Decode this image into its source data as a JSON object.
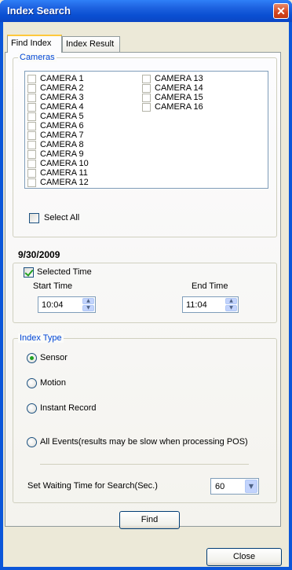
{
  "window": {
    "title": "Index Search",
    "close_glyph": "✕"
  },
  "tabs": [
    {
      "label": "Find Index",
      "active": true
    },
    {
      "label": "Index Result",
      "active": false
    }
  ],
  "cameras": {
    "group_label": "Cameras",
    "items": [
      {
        "label": "CAMERA 1",
        "checked": false
      },
      {
        "label": "CAMERA 2",
        "checked": false
      },
      {
        "label": "CAMERA 3",
        "checked": false
      },
      {
        "label": "CAMERA 4",
        "checked": false
      },
      {
        "label": "CAMERA 5",
        "checked": false
      },
      {
        "label": "CAMERA 6",
        "checked": false
      },
      {
        "label": "CAMERA 7",
        "checked": false
      },
      {
        "label": "CAMERA 8",
        "checked": false
      },
      {
        "label": "CAMERA 9",
        "checked": false
      },
      {
        "label": "CAMERA 10",
        "checked": false
      },
      {
        "label": "CAMERA 11",
        "checked": false
      },
      {
        "label": "CAMERA 12",
        "checked": false
      },
      {
        "label": "CAMERA 13",
        "checked": false
      },
      {
        "label": "CAMERA 14",
        "checked": false
      },
      {
        "label": "CAMERA 15",
        "checked": false
      },
      {
        "label": "CAMERA 16",
        "checked": false
      }
    ],
    "select_all_label": "Select All",
    "select_all_checked": false
  },
  "date": "9/30/2009",
  "time": {
    "selected_time_label": "Selected Time",
    "selected_time_checked": true,
    "start_label": "Start Time",
    "start_value": "10:04",
    "end_label": "End Time",
    "end_value": "11:04"
  },
  "index_type": {
    "group_label": "Index Type",
    "options": [
      {
        "label": "Sensor",
        "selected": true
      },
      {
        "label": "Motion",
        "selected": false
      },
      {
        "label": "Instant Record",
        "selected": false
      },
      {
        "label": "All Events(results may be slow when processing POS)",
        "selected": false
      }
    ],
    "waiting_label": "Set Waiting Time for Search(Sec.)",
    "waiting_value": "60"
  },
  "buttons": {
    "find": "Find",
    "close": "Close"
  },
  "colors": {
    "title_bar": "#0a4fd2",
    "group_label": "#0046d5",
    "check_mark": "#21a121"
  }
}
